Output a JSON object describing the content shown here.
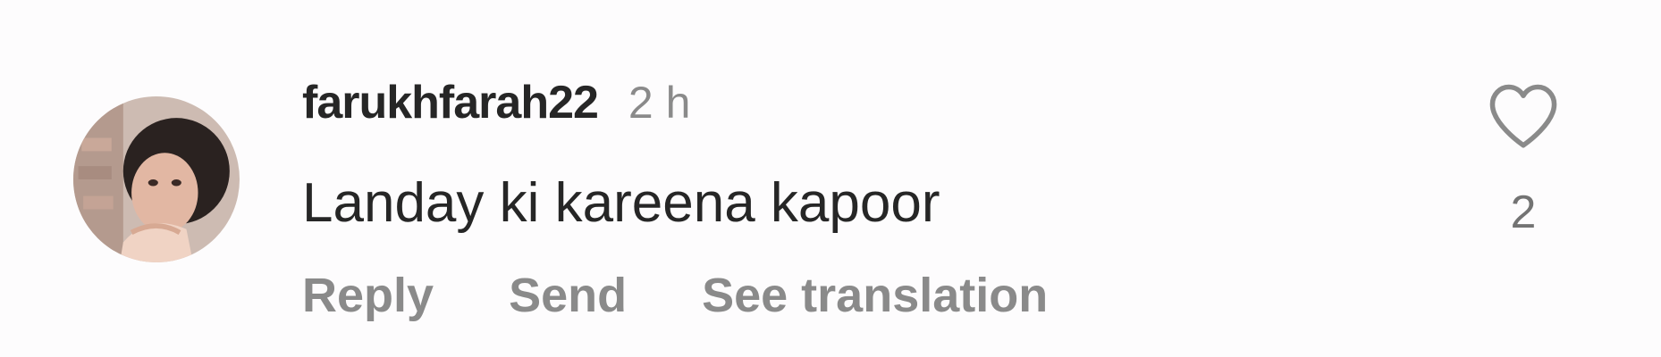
{
  "comment": {
    "avatar_icon": "user-avatar-photo",
    "username": "farukhfarah22",
    "timestamp": "2 h",
    "text": "Landay ki kareena kapoor",
    "actions": {
      "reply": "Reply",
      "send": "Send",
      "see_translation": "See translation"
    },
    "like_icon": "heart-outline-icon",
    "like_count": "2"
  },
  "colors": {
    "background": "#fdfcfd",
    "primary_text": "#262626",
    "secondary_text": "#8a8a8a"
  }
}
